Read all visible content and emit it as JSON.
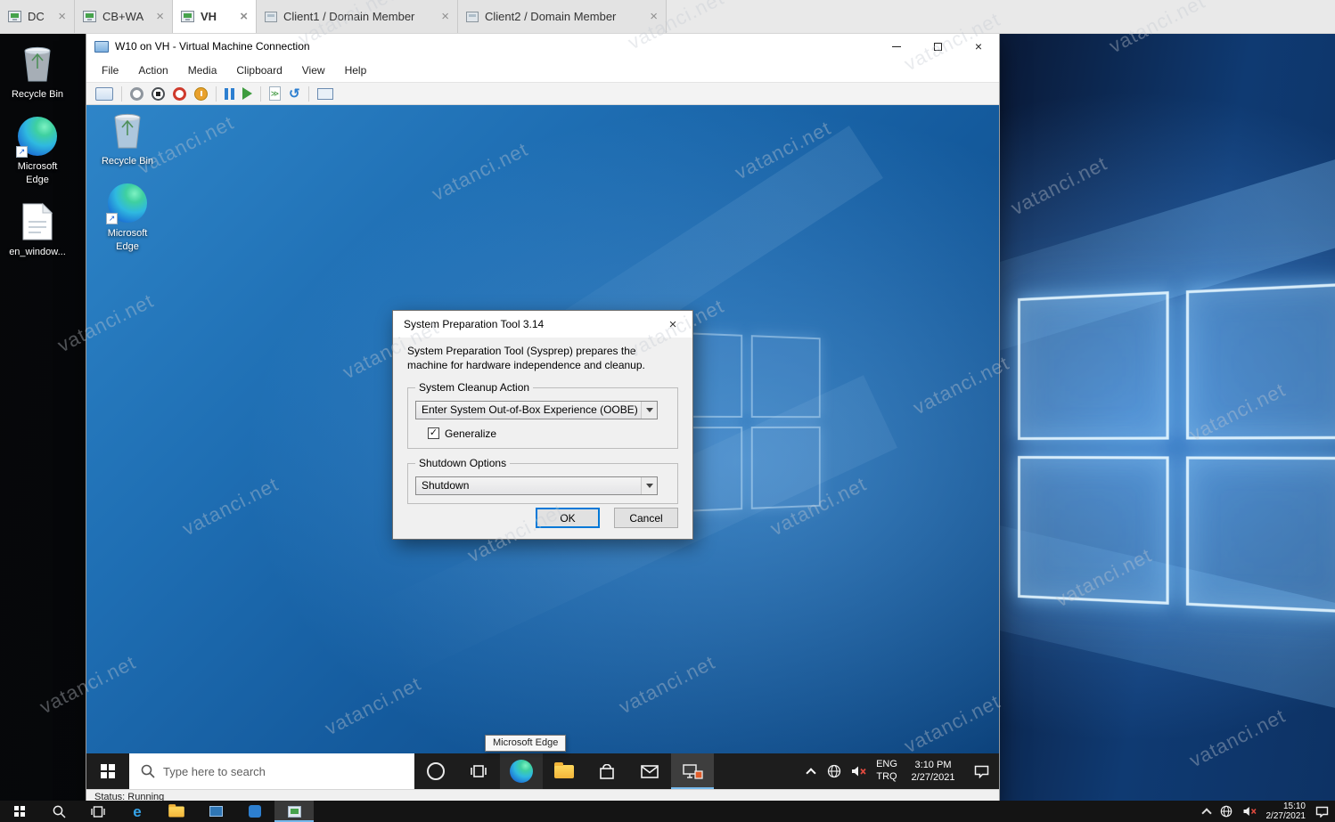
{
  "watermark": {
    "text": "vatanci.net"
  },
  "colors": {
    "accent_blue": "#0078d7",
    "vm_wallpaper_blue": "#1f6fb4",
    "taskbar_dark": "#1d1d1d",
    "dialog_bg": "#f0f0f0",
    "tab_active_bg": "#ffffff"
  },
  "host": {
    "tabs": [
      {
        "label": "DC"
      },
      {
        "label": "CB+WA"
      },
      {
        "label": "VH",
        "active": true
      },
      {
        "label": "Client1 / Domain Member"
      },
      {
        "label": "Client2 / Domain Member"
      }
    ],
    "desktop_icons": [
      {
        "label": "Recycle Bin",
        "icon": "recycle-bin-icon"
      },
      {
        "label": "Microsoft Edge",
        "icon": "edge-icon"
      },
      {
        "label": "en_window...",
        "icon": "file-icon"
      }
    ],
    "taskbar": {
      "time": "15:10",
      "date": "2/27/2021",
      "icons": [
        "start",
        "search",
        "task-view",
        "edge",
        "file-explorer",
        "app-window",
        "app",
        "server-manager",
        "chevron-up",
        "network-globe",
        "volume-muted",
        "clock",
        "notifications"
      ]
    }
  },
  "vmconnect": {
    "title": "W10 on VH - Virtual Machine Connection",
    "menus": [
      "File",
      "Action",
      "Media",
      "Clipboard",
      "View",
      "Help"
    ],
    "toolbar_icons": [
      "ctrl-alt-del",
      "start",
      "turn-off",
      "shut-down",
      "save",
      "pause",
      "reset",
      "checkpoint",
      "revert",
      "enhanced-session"
    ],
    "window_buttons": [
      "minimize",
      "maximize",
      "close"
    ],
    "status": "Status: Running"
  },
  "vm": {
    "desktop_icons": [
      {
        "label": "Recycle Bin",
        "icon": "recycle-bin-icon"
      },
      {
        "label": "Microsoft Edge",
        "icon": "edge-icon"
      }
    ],
    "tooltip": "Microsoft Edge",
    "taskbar": {
      "search_placeholder": "Type here to search",
      "icons": [
        "start",
        "search",
        "cortana",
        "task-view",
        "edge",
        "file-explorer",
        "store",
        "mail",
        "network-app"
      ],
      "tray": {
        "language_primary": "ENG",
        "language_secondary": "TRQ",
        "time": "3:10 PM",
        "date": "2/27/2021",
        "icons": [
          "chevron-up",
          "network-globe",
          "volume-muted",
          "action-center"
        ]
      }
    }
  },
  "dialog": {
    "title": "System Preparation Tool 3.14",
    "description": "System Preparation Tool (Sysprep) prepares the machine for hardware independence and cleanup.",
    "cleanup_group_label": "System Cleanup Action",
    "cleanup_selected": "Enter System Out-of-Box Experience (OOBE)",
    "generalize_label": "Generalize",
    "generalize_checked": true,
    "shutdown_group_label": "Shutdown Options",
    "shutdown_selected": "Shutdown",
    "ok_label": "OK",
    "cancel_label": "Cancel"
  }
}
